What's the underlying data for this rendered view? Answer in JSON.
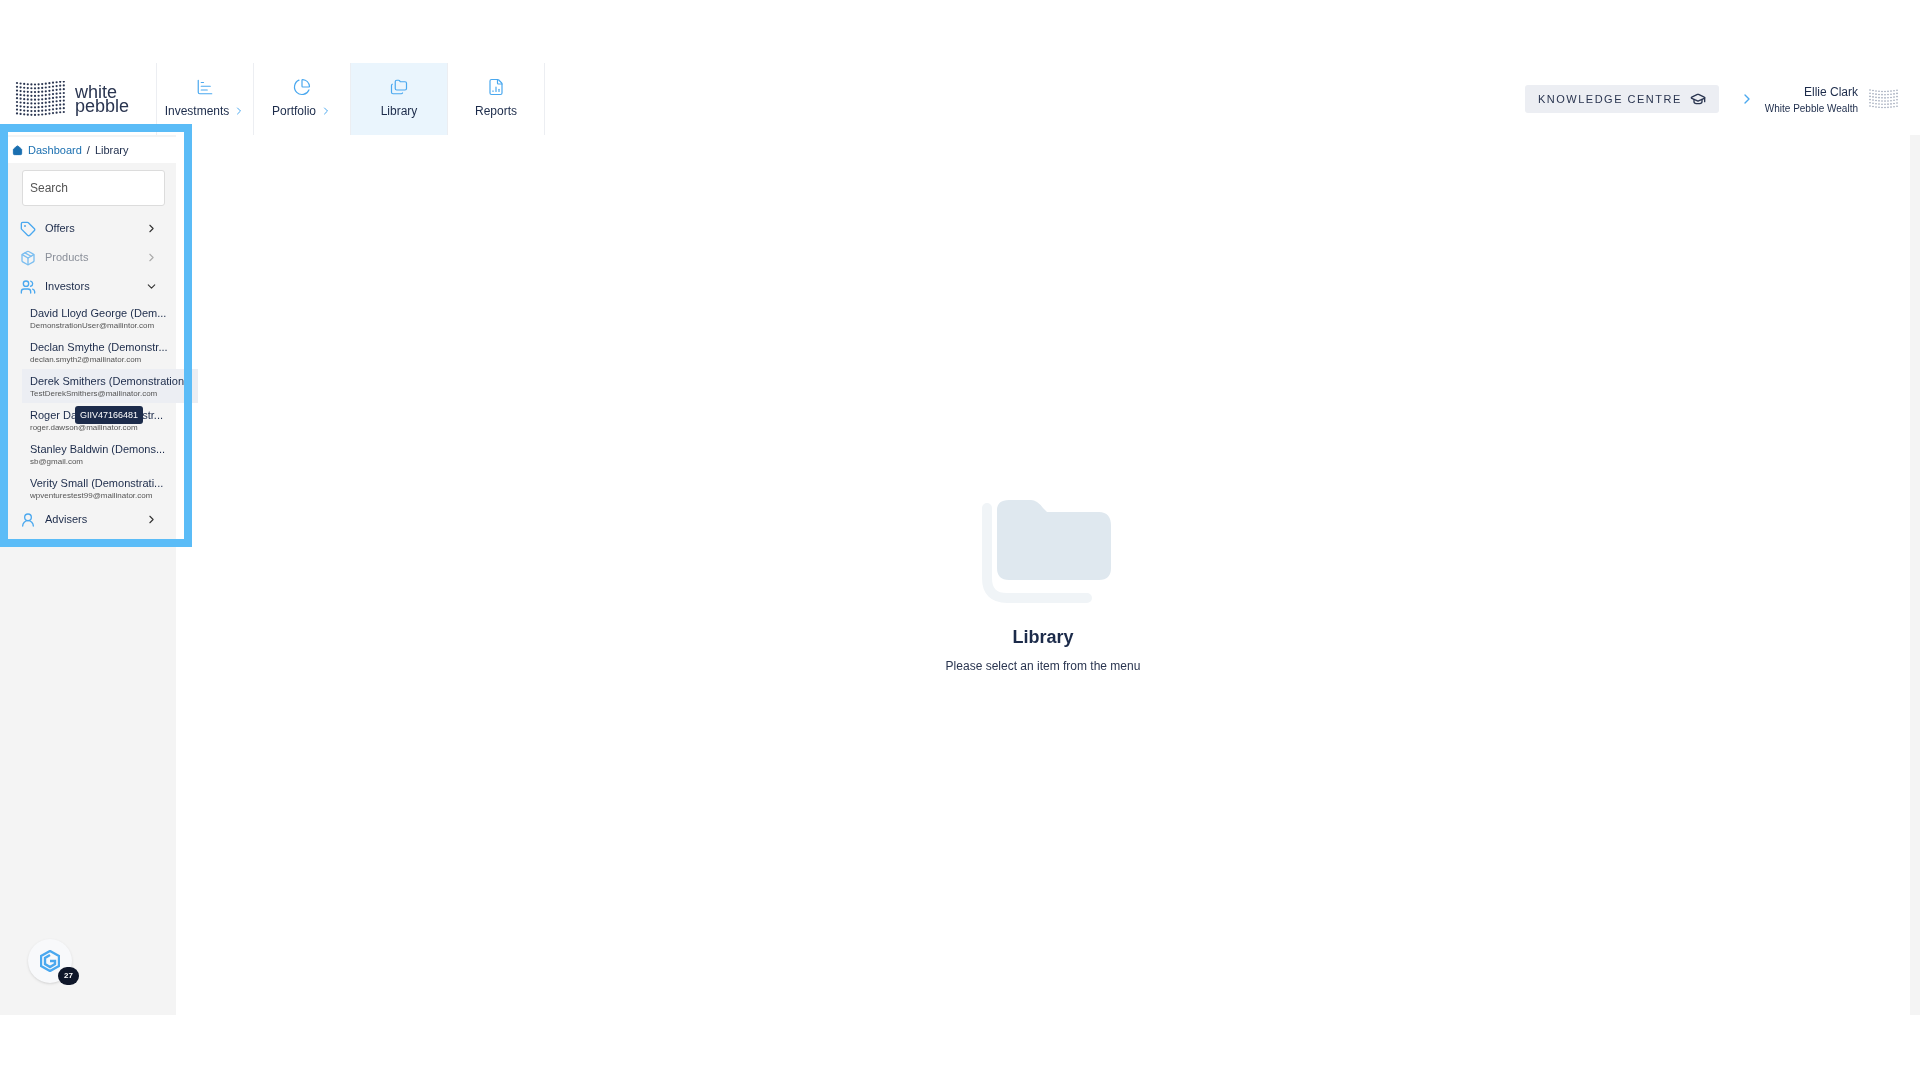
{
  "logo": {
    "line1": "white",
    "line2": "pebble"
  },
  "tabs": [
    {
      "label": "Investments",
      "kind": "investments",
      "has_menu": true,
      "selected": false
    },
    {
      "label": "Portfolio",
      "kind": "portfolio",
      "has_menu": true,
      "selected": false
    },
    {
      "label": "Library",
      "kind": "library",
      "has_menu": false,
      "selected": true
    },
    {
      "label": "Reports",
      "kind": "reports",
      "has_menu": false,
      "selected": false
    }
  ],
  "knowledge_button": "KNOWLEDGE CENTRE",
  "user": {
    "name": "Ellie Clark",
    "company": "White Pebble Wealth"
  },
  "breadcrumb": [
    "Dashboard",
    "/",
    "Library"
  ],
  "search": {
    "placeholder": "Search"
  },
  "menu": [
    {
      "label": "Offers",
      "kind": "offers",
      "disabled": false,
      "expanded": false
    },
    {
      "label": "Products",
      "kind": "products",
      "disabled": true,
      "expanded": false
    },
    {
      "label": "Investors",
      "kind": "investors",
      "disabled": false,
      "expanded": true,
      "children": [
        {
          "name": "David Lloyd George (Dem...",
          "email": "DemonstrationUser@mailintor.com",
          "selected": false
        },
        {
          "name": "Declan Smythe (Demonstr...",
          "email": "declan.smyth2@mailinator.com",
          "selected": false
        },
        {
          "name": "Derek Smithers (Demonstration",
          "email": "TestDerekSmithers@mailinator.com",
          "selected": true
        },
        {
          "name": "Roger Da",
          "name_end": "str...",
          "email": "roger.dawson@mailinator.com",
          "selected": false,
          "tooltip": "GIIV47166481"
        },
        {
          "name": "Stanley Baldwin (Demons...",
          "email": "sb@gmail.com",
          "selected": false
        },
        {
          "name": "Verity Small (Demonstrati...",
          "email": "wpventurestest99@mailinator.com",
          "selected": false
        }
      ]
    },
    {
      "label": "Advisers",
      "kind": "advisers",
      "disabled": false,
      "expanded": false
    }
  ],
  "empty_state": {
    "title": "Library",
    "message": "Please select an item from the menu"
  },
  "chat_badge": "27"
}
